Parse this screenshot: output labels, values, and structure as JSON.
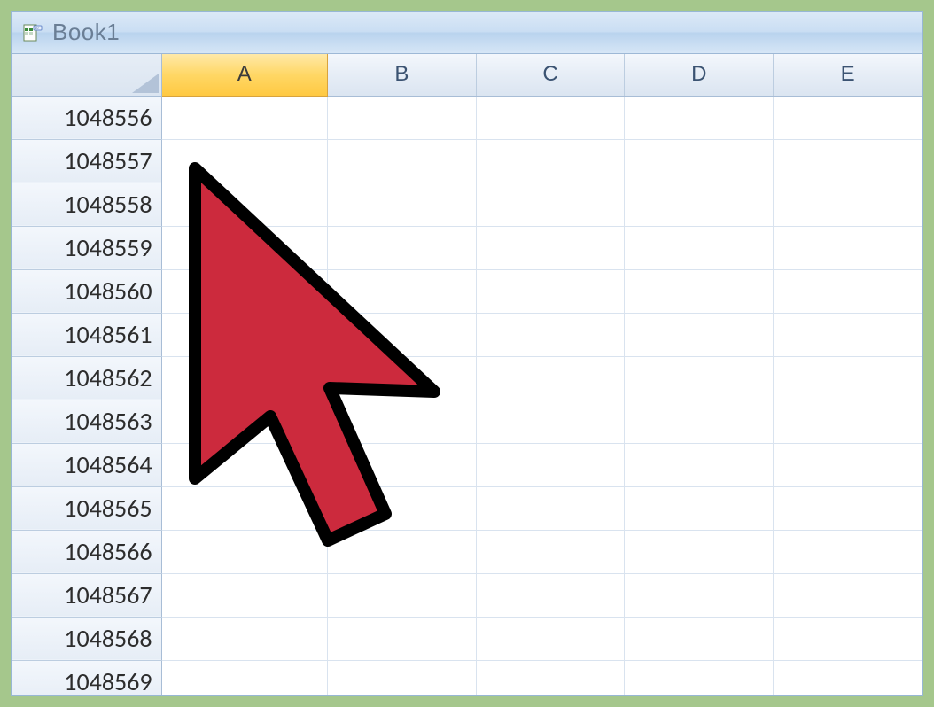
{
  "titlebar": {
    "title": "Book1"
  },
  "columns": [
    {
      "label": "A",
      "selected": true
    },
    {
      "label": "B",
      "selected": false
    },
    {
      "label": "C",
      "selected": false
    },
    {
      "label": "D",
      "selected": false
    },
    {
      "label": "E",
      "selected": false
    }
  ],
  "rows": [
    "1048556",
    "1048557",
    "1048558",
    "1048559",
    "1048560",
    "1048561",
    "1048562",
    "1048563",
    "1048564",
    "1048565",
    "1048566",
    "1048567",
    "1048568",
    "1048569"
  ],
  "colors": {
    "cursor_fill": "#cc2a3d",
    "cursor_stroke": "#000000"
  }
}
